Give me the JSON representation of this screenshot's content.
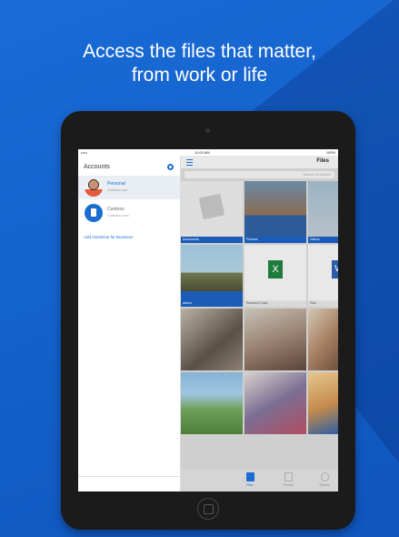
{
  "headline": {
    "line1": "Access the files that matter,",
    "line2": "from work or life"
  },
  "status": {
    "carrier": "•••••",
    "time": "11:00 AM",
    "battery": "100%"
  },
  "sidebar": {
    "title": "Accounts",
    "accounts": [
      {
        "name": "Personal",
        "sub": "Outlook.com"
      },
      {
        "name": "Contoso",
        "sub": "Contoso.com"
      }
    ],
    "add_business": "Add OneDrive for Business"
  },
  "main": {
    "title": "Files",
    "search_placeholder": "Search OneDrive",
    "tiles": [
      {
        "label": "Documents"
      },
      {
        "label": "Pictures"
      },
      {
        "label": "Videos"
      },
      {
        "label": "Album"
      },
      {
        "label": "Research Data"
      },
      {
        "label": "Plan"
      }
    ],
    "tabs": [
      {
        "label": "Files"
      },
      {
        "label": "Photos"
      },
      {
        "label": "Recent"
      }
    ]
  },
  "colors": {
    "accent": "#1b6ed0",
    "background": "#1462cc",
    "caption": "#1a5cb8"
  }
}
